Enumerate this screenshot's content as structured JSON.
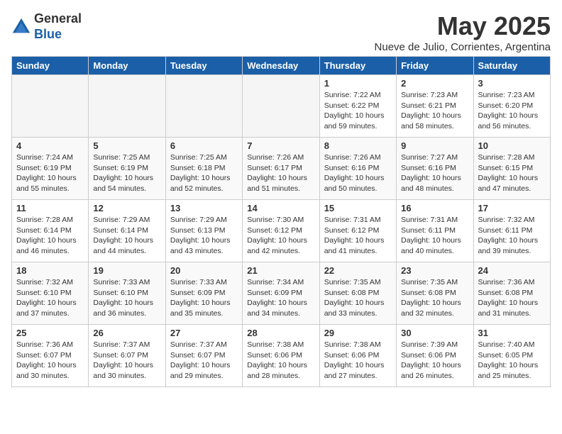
{
  "logo": {
    "general": "General",
    "blue": "Blue"
  },
  "title": "May 2025",
  "location": "Nueve de Julio, Corrientes, Argentina",
  "days_of_week": [
    "Sunday",
    "Monday",
    "Tuesday",
    "Wednesday",
    "Thursday",
    "Friday",
    "Saturday"
  ],
  "weeks": [
    [
      {
        "day": "",
        "info": ""
      },
      {
        "day": "",
        "info": ""
      },
      {
        "day": "",
        "info": ""
      },
      {
        "day": "",
        "info": ""
      },
      {
        "day": "1",
        "info": "Sunrise: 7:22 AM\nSunset: 6:22 PM\nDaylight: 10 hours\nand 59 minutes."
      },
      {
        "day": "2",
        "info": "Sunrise: 7:23 AM\nSunset: 6:21 PM\nDaylight: 10 hours\nand 58 minutes."
      },
      {
        "day": "3",
        "info": "Sunrise: 7:23 AM\nSunset: 6:20 PM\nDaylight: 10 hours\nand 56 minutes."
      }
    ],
    [
      {
        "day": "4",
        "info": "Sunrise: 7:24 AM\nSunset: 6:19 PM\nDaylight: 10 hours\nand 55 minutes."
      },
      {
        "day": "5",
        "info": "Sunrise: 7:25 AM\nSunset: 6:19 PM\nDaylight: 10 hours\nand 54 minutes."
      },
      {
        "day": "6",
        "info": "Sunrise: 7:25 AM\nSunset: 6:18 PM\nDaylight: 10 hours\nand 52 minutes."
      },
      {
        "day": "7",
        "info": "Sunrise: 7:26 AM\nSunset: 6:17 PM\nDaylight: 10 hours\nand 51 minutes."
      },
      {
        "day": "8",
        "info": "Sunrise: 7:26 AM\nSunset: 6:16 PM\nDaylight: 10 hours\nand 50 minutes."
      },
      {
        "day": "9",
        "info": "Sunrise: 7:27 AM\nSunset: 6:16 PM\nDaylight: 10 hours\nand 48 minutes."
      },
      {
        "day": "10",
        "info": "Sunrise: 7:28 AM\nSunset: 6:15 PM\nDaylight: 10 hours\nand 47 minutes."
      }
    ],
    [
      {
        "day": "11",
        "info": "Sunrise: 7:28 AM\nSunset: 6:14 PM\nDaylight: 10 hours\nand 46 minutes."
      },
      {
        "day": "12",
        "info": "Sunrise: 7:29 AM\nSunset: 6:14 PM\nDaylight: 10 hours\nand 44 minutes."
      },
      {
        "day": "13",
        "info": "Sunrise: 7:29 AM\nSunset: 6:13 PM\nDaylight: 10 hours\nand 43 minutes."
      },
      {
        "day": "14",
        "info": "Sunrise: 7:30 AM\nSunset: 6:12 PM\nDaylight: 10 hours\nand 42 minutes."
      },
      {
        "day": "15",
        "info": "Sunrise: 7:31 AM\nSunset: 6:12 PM\nDaylight: 10 hours\nand 41 minutes."
      },
      {
        "day": "16",
        "info": "Sunrise: 7:31 AM\nSunset: 6:11 PM\nDaylight: 10 hours\nand 40 minutes."
      },
      {
        "day": "17",
        "info": "Sunrise: 7:32 AM\nSunset: 6:11 PM\nDaylight: 10 hours\nand 39 minutes."
      }
    ],
    [
      {
        "day": "18",
        "info": "Sunrise: 7:32 AM\nSunset: 6:10 PM\nDaylight: 10 hours\nand 37 minutes."
      },
      {
        "day": "19",
        "info": "Sunrise: 7:33 AM\nSunset: 6:10 PM\nDaylight: 10 hours\nand 36 minutes."
      },
      {
        "day": "20",
        "info": "Sunrise: 7:33 AM\nSunset: 6:09 PM\nDaylight: 10 hours\nand 35 minutes."
      },
      {
        "day": "21",
        "info": "Sunrise: 7:34 AM\nSunset: 6:09 PM\nDaylight: 10 hours\nand 34 minutes."
      },
      {
        "day": "22",
        "info": "Sunrise: 7:35 AM\nSunset: 6:08 PM\nDaylight: 10 hours\nand 33 minutes."
      },
      {
        "day": "23",
        "info": "Sunrise: 7:35 AM\nSunset: 6:08 PM\nDaylight: 10 hours\nand 32 minutes."
      },
      {
        "day": "24",
        "info": "Sunrise: 7:36 AM\nSunset: 6:08 PM\nDaylight: 10 hours\nand 31 minutes."
      }
    ],
    [
      {
        "day": "25",
        "info": "Sunrise: 7:36 AM\nSunset: 6:07 PM\nDaylight: 10 hours\nand 30 minutes."
      },
      {
        "day": "26",
        "info": "Sunrise: 7:37 AM\nSunset: 6:07 PM\nDaylight: 10 hours\nand 30 minutes."
      },
      {
        "day": "27",
        "info": "Sunrise: 7:37 AM\nSunset: 6:07 PM\nDaylight: 10 hours\nand 29 minutes."
      },
      {
        "day": "28",
        "info": "Sunrise: 7:38 AM\nSunset: 6:06 PM\nDaylight: 10 hours\nand 28 minutes."
      },
      {
        "day": "29",
        "info": "Sunrise: 7:38 AM\nSunset: 6:06 PM\nDaylight: 10 hours\nand 27 minutes."
      },
      {
        "day": "30",
        "info": "Sunrise: 7:39 AM\nSunset: 6:06 PM\nDaylight: 10 hours\nand 26 minutes."
      },
      {
        "day": "31",
        "info": "Sunrise: 7:40 AM\nSunset: 6:05 PM\nDaylight: 10 hours\nand 25 minutes."
      }
    ]
  ]
}
